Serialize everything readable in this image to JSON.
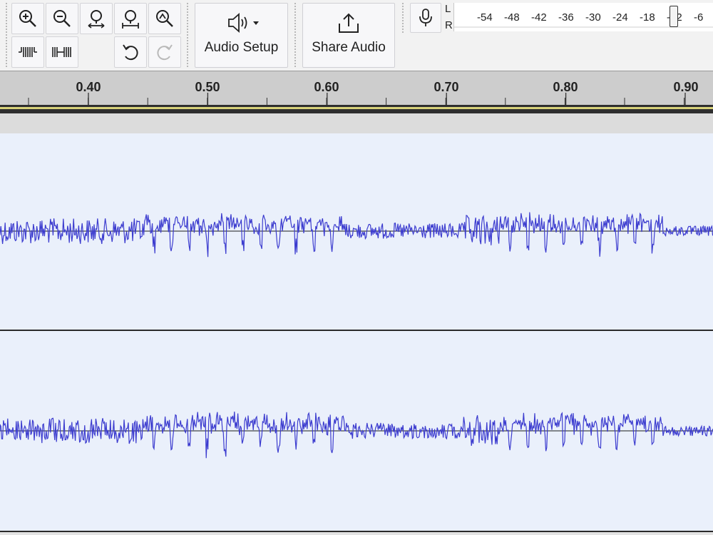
{
  "toolbar": {
    "audio_setup_label": "Audio Setup",
    "share_audio_label": "Share Audio",
    "meter_channel_left": "L",
    "meter_channel_right": "R",
    "meter_ticks": [
      "-54",
      "-48",
      "-42",
      "-36",
      "-30",
      "-24",
      "-18",
      "-12",
      "-6"
    ]
  },
  "ruler": {
    "labels": [
      "0.40",
      "0.50",
      "0.60",
      "0.70",
      "0.80",
      "0.90"
    ]
  },
  "colors": {
    "waveform": "#3c3ccf",
    "track_background": "#eaf0fb",
    "ruler_background": "#cdcdcd"
  }
}
